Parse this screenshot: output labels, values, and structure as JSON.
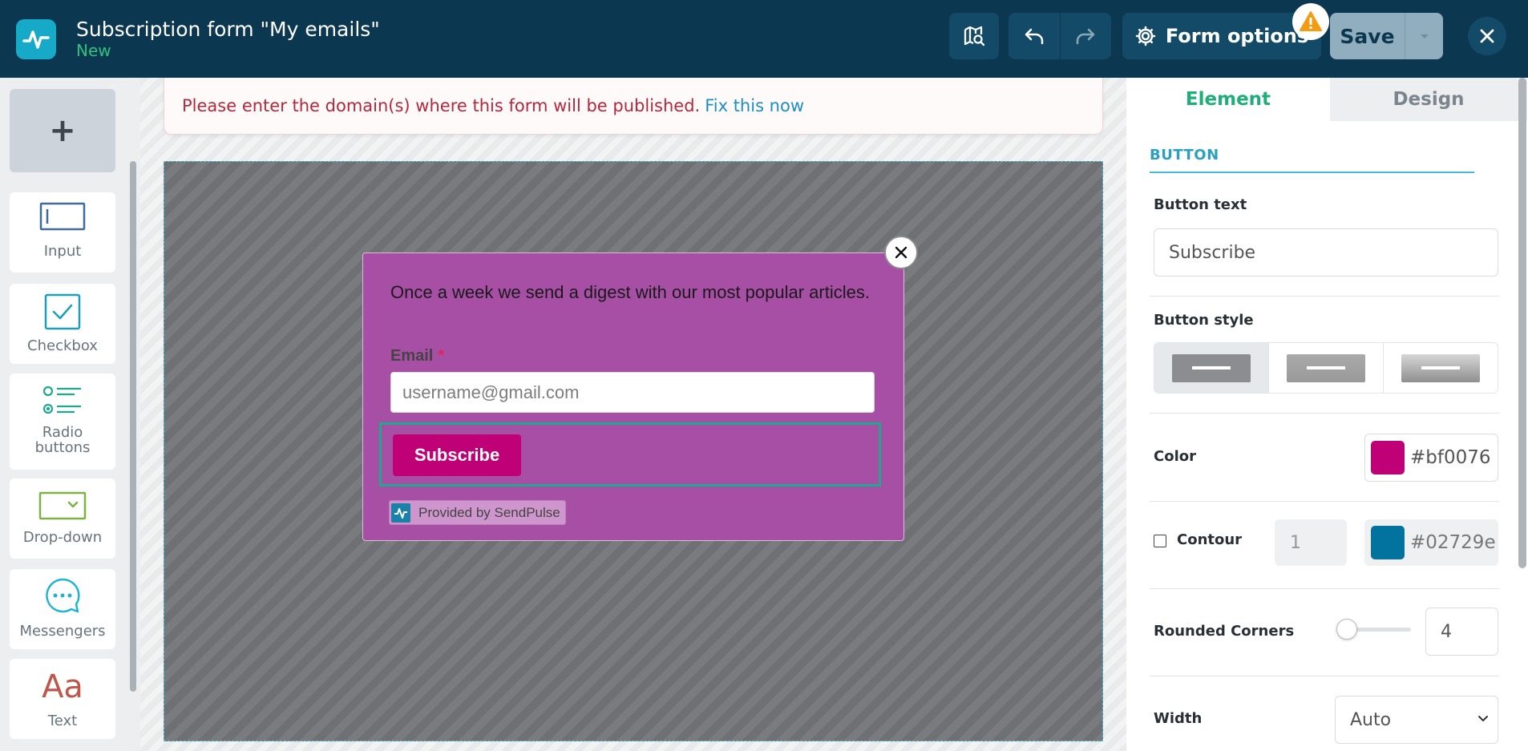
{
  "header": {
    "title": "Subscription form \"My emails\"",
    "status": "New",
    "form_options_label": "Form options",
    "save_label": "Save"
  },
  "sidebar": {
    "add_label": "+",
    "tools": [
      {
        "label": "Input",
        "icon": "input-field-icon"
      },
      {
        "label": "Checkbox",
        "icon": "checkbox-icon"
      },
      {
        "label": "Radio buttons",
        "icon": "radio-buttons-icon"
      },
      {
        "label": "Drop-down",
        "icon": "dropdown-icon"
      },
      {
        "label": "Messengers",
        "icon": "chat-bubble-icon"
      },
      {
        "label": "Text",
        "icon": "text-aa-icon"
      }
    ]
  },
  "notice": {
    "message": "Please enter the domain(s) where this form will be published.",
    "link": "Fix this now"
  },
  "popup": {
    "description": "Once a week we send a digest with our most popular articles.",
    "email_label": "Email",
    "required_mark": "*",
    "email_placeholder": "username@gmail.com",
    "button_label": "Subscribe",
    "provided_by": "Provided by SendPulse",
    "button_color": "#bf0076",
    "background_color": "#a64fa5"
  },
  "panel": {
    "tabs": [
      "Element",
      "Design"
    ],
    "active_tab": "Element",
    "section_title": "BUTTON",
    "button_text_label": "Button text",
    "button_text_value": "Subscribe",
    "button_style_label": "Button style",
    "color_label": "Color",
    "color_value": "#bf0076",
    "contour_label": "Contour",
    "contour_checked": false,
    "contour_width": "1",
    "contour_color": "#02729e",
    "rounded_corners_label": "Rounded Corners",
    "rounded_corners_value": "4",
    "width_label": "Width",
    "width_value": "Auto"
  },
  "colors": {
    "topbar": "#0b3750",
    "accent_green": "#1fad79",
    "accent_blue": "#2aa1c1",
    "error_red": "#b3283a"
  }
}
